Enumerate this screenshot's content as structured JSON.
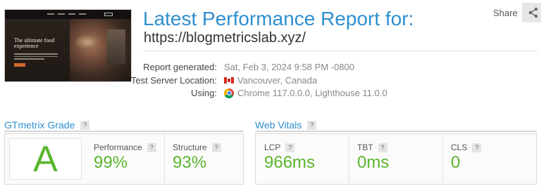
{
  "report": {
    "title": "Latest Performance Report for:",
    "url": "https://blogmetricslab.xyz/"
  },
  "share": {
    "label": "Share",
    "icon": "share-icon"
  },
  "thumbnail": {
    "headline": "The ultimate food experience"
  },
  "meta": {
    "generated_label": "Report generated:",
    "generated_value": "Sat, Feb 3, 2024 9:58 PM -0800",
    "location_label": "Test Server Location:",
    "location_value": "Vancouver, Canada",
    "location_icon": "canada-flag-icon",
    "using_label": "Using:",
    "using_value": "Chrome 117.0.0.0, Lighthouse 11.0.0",
    "using_icon": "chrome-icon"
  },
  "gtmetrix": {
    "title": "GTmetrix Grade",
    "help": "?",
    "grade": "A",
    "performance_label": "Performance",
    "performance_value": "99%",
    "structure_label": "Structure",
    "structure_value": "93%"
  },
  "web_vitals": {
    "title": "Web Vitals",
    "help": "?",
    "lcp_label": "LCP",
    "lcp_value": "966ms",
    "tbt_label": "TBT",
    "tbt_value": "0ms",
    "cls_label": "CLS",
    "cls_value": "0"
  },
  "colors": {
    "accent": "#2e8fd0",
    "good": "#5ab52e"
  }
}
